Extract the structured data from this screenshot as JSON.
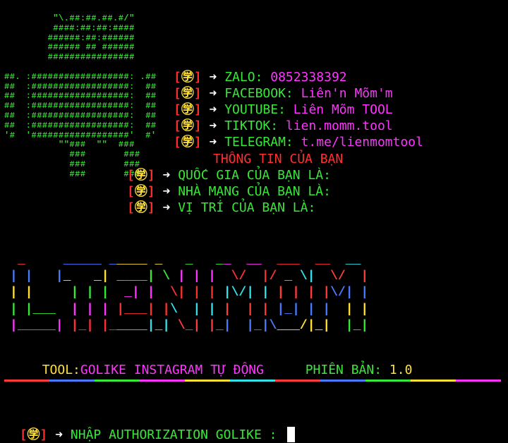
{
  "robot_art": [
    "         \"\\.##:##.##.#/\"",
    "         ####:##:##:####",
    "        ######:##:######",
    "        ###### ## ######",
    "        ################",
    "",
    "##. :##################: .##",
    "##  :##################:  ##",
    "##  :##################:  ##",
    "##  :##################:  ##",
    "##  :##################:  ##",
    "##  :##################:  ##",
    "'#  '##################'  #'",
    "          \"\"###  \"\"  ###",
    "            ###       ###",
    "            ###       ###",
    "            ###       ###"
  ],
  "prefix": {
    "open": "[",
    "glyph": "㊫",
    "close": "]",
    "arrow": "➜"
  },
  "contacts": [
    {
      "label": "ZALO: ",
      "value": "0852338392"
    },
    {
      "label": "FACEBOOK: ",
      "value": "Liên'n Mõm'm"
    },
    {
      "label": "YOUTUBE: ",
      "value": "Liên Mõm TOOL"
    },
    {
      "label": "TIKTOK: ",
      "value": "lien.momm.tool"
    },
    {
      "label": "TELEGRAM: ",
      "value": "t.me/lienmomtool"
    }
  ],
  "info_header": "THÔNG TIN CỦA BẠN",
  "info_items": [
    "QUỐC GIA CỦA BẠN LÀ:",
    "NHÀ MẠNG CỦA BẠN LÀ:",
    "VỊ TRÍ CỦA BẠN LÀ:"
  ],
  "banner_lines": [
    " _     _____ _____ _   _   __  __  ___  __  __",
    "| |   |_   _| ____| \\ | | |  \\/  |/ _ \\|  \\/  |",
    "| |     | | |  _| |  \\| | | |\\/| | | | | |\\/| |",
    "| |___  | | | |___| |\\  | | |  | | |_| | |  | |",
    "|_____| |_| |_____|_| \\_| |_|  |_|\\___/|_|  |_|"
  ],
  "banner_colors": [
    "#ff3b3b",
    "#4a7bff",
    "#ffe033",
    "#38e838",
    "#ff35ff",
    "#ff3030",
    "#33e0e8"
  ],
  "tool": {
    "label": "TOOL:",
    "name": "GOLIKE INSTAGRAM TỰ ĐỘNG",
    "version_label": "PHIÊN BẢN: ",
    "version": "1.0"
  },
  "divider_colors": [
    "#ff3b3b",
    "#4a7bff",
    "#38e838",
    "#ff35ff",
    "#ffe033",
    "#33e0e8",
    "#ff3b3b",
    "#4a7bff",
    "#38e838",
    "#ffe033",
    "#ff35ff"
  ],
  "prompt": {
    "text": "NHẬP AUTHORIZATION GOLIKE : "
  }
}
